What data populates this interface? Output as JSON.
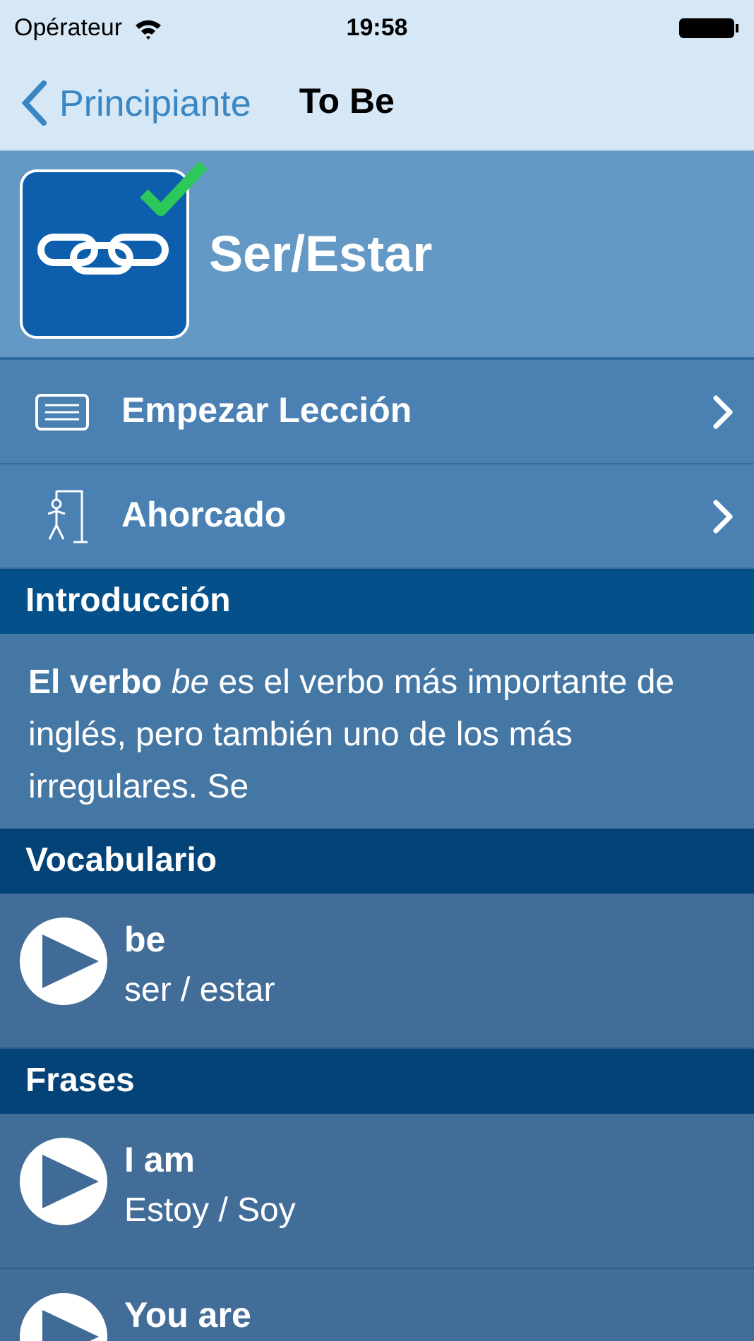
{
  "status_bar": {
    "carrier": "Opérateur",
    "time": "19:58"
  },
  "nav": {
    "back": "Principiante",
    "title": "To Be"
  },
  "lesson": {
    "title": "Ser/Estar",
    "completed": true
  },
  "actions": [
    {
      "kind": "cards",
      "label": "Empezar Lección"
    },
    {
      "kind": "hangman",
      "label": "Ahorcado"
    }
  ],
  "intro": {
    "heading": "Introducción",
    "text": "**El verbo** *be* es el verbo más importante de inglés, pero también uno de los más irregulares. Se"
  },
  "sections": [
    {
      "heading": "Vocabulario",
      "items": [
        {
          "term": "be",
          "translation": "ser / estar"
        }
      ]
    },
    {
      "heading": "Frases",
      "items": [
        {
          "term": "I am",
          "translation": "Estoy / Soy"
        },
        {
          "term": "You are"
        }
      ]
    }
  ]
}
